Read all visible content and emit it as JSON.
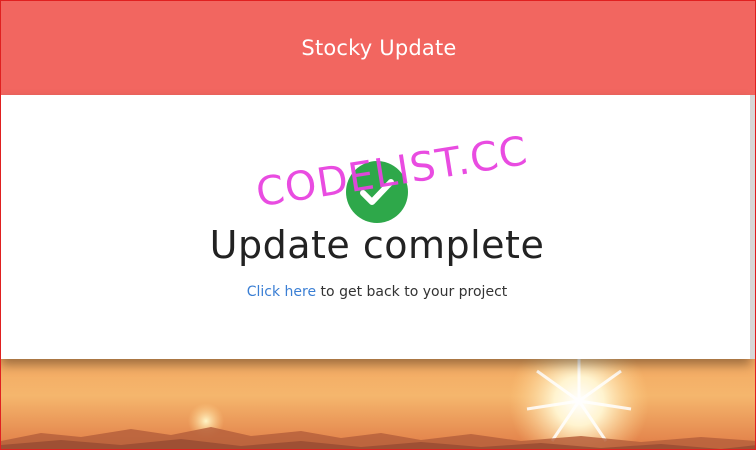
{
  "header": {
    "title": "Stocky Update"
  },
  "status": {
    "icon": "check-circle-icon",
    "title": "Update complete",
    "link_text": "Click here",
    "message_rest": " to get back to your project"
  },
  "watermark": {
    "text": "CODELIST.CC"
  },
  "colors": {
    "header_bg": "#f26660",
    "success": "#2ea84a",
    "link": "#3b7fd4",
    "watermark": "#e843e0"
  }
}
